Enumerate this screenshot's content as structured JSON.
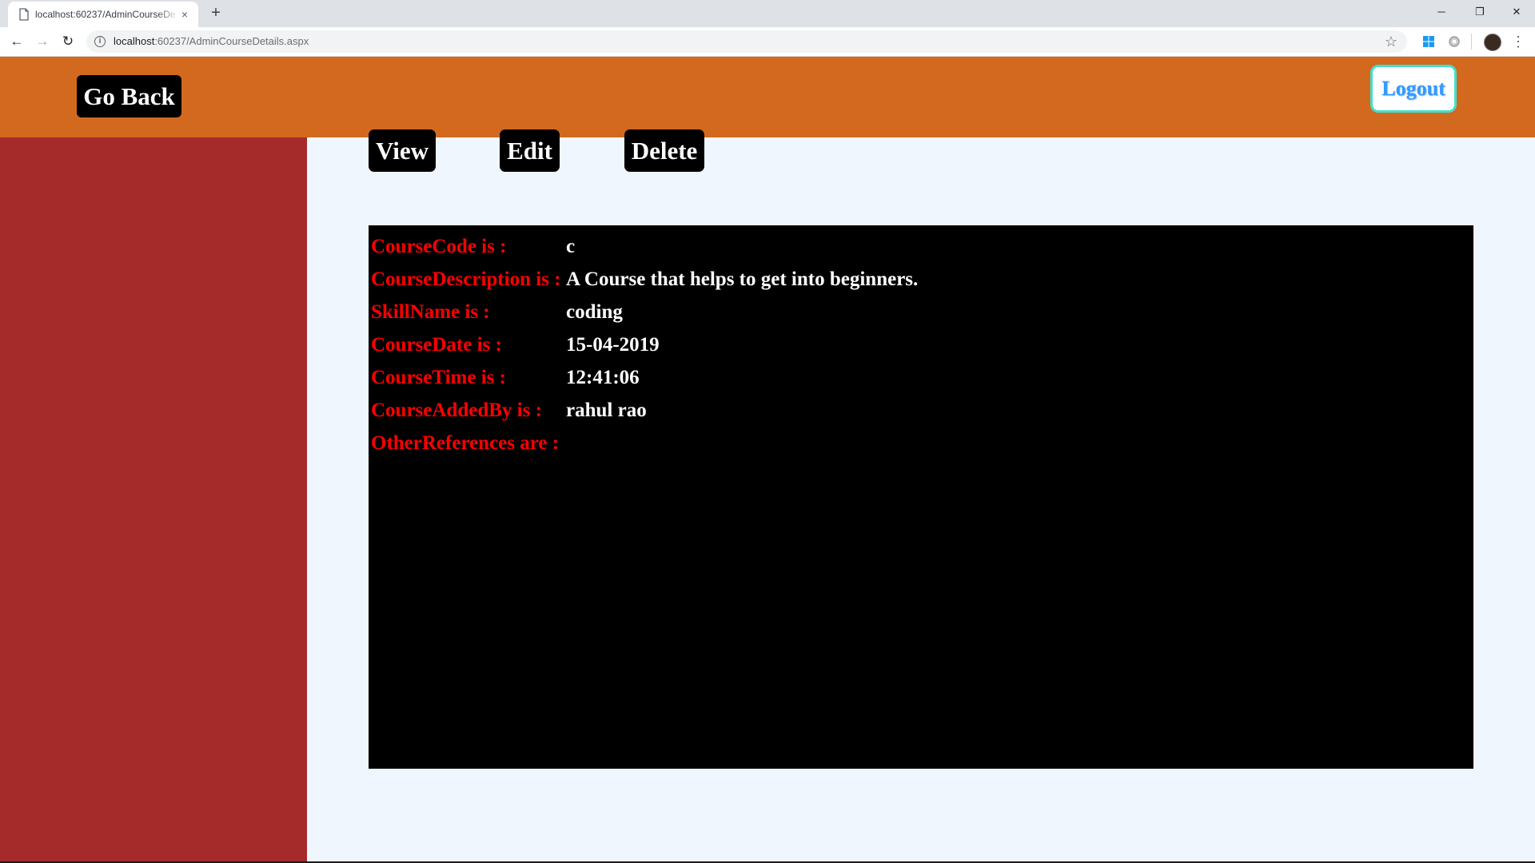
{
  "browser": {
    "tab_title": "localhost:60237/AdminCourseDe",
    "tab_close": "×",
    "new_tab": "+",
    "window_controls": {
      "minimize": "─",
      "restore": "❐",
      "close": "✕"
    },
    "nav": {
      "back": "←",
      "forward": "→",
      "reload": "↻"
    },
    "address": {
      "host": "localhost",
      "rest": ":60237/AdminCourseDetails.aspx"
    },
    "icons": [
      "page-icon",
      "info-icon",
      "star-icon",
      "windows-extension-icon",
      "circle-extension-icon",
      "profile-avatar",
      "menu-dots-icon"
    ]
  },
  "header": {
    "go_back_label": "Go Back",
    "logout_label": "Logout"
  },
  "actions": {
    "view_label": "View",
    "edit_label": "Edit",
    "delete_label": "Delete"
  },
  "details": [
    {
      "label": "CourseCode is :",
      "value": "c"
    },
    {
      "label": "CourseDescription is :",
      "value": "A Course that helps to get into beginners."
    },
    {
      "label": "SkillName is :",
      "value": "coding"
    },
    {
      "label": "CourseDate is :",
      "value": "15-04-2019"
    },
    {
      "label": "CourseTime is :",
      "value": "12:41:06"
    },
    {
      "label": "CourseAddedBy is :",
      "value": "rahul rao"
    },
    {
      "label": "OtherReferences are :",
      "value": ""
    }
  ],
  "colors": {
    "header": "#d2691e",
    "sidebar": "#a52a2a",
    "content_bg": "#f0f6fd",
    "panel": "#000000",
    "label": "#ff0000",
    "value": "#ffffff",
    "logout_border": "#40e0d0",
    "logout_text": "#3399ff"
  }
}
